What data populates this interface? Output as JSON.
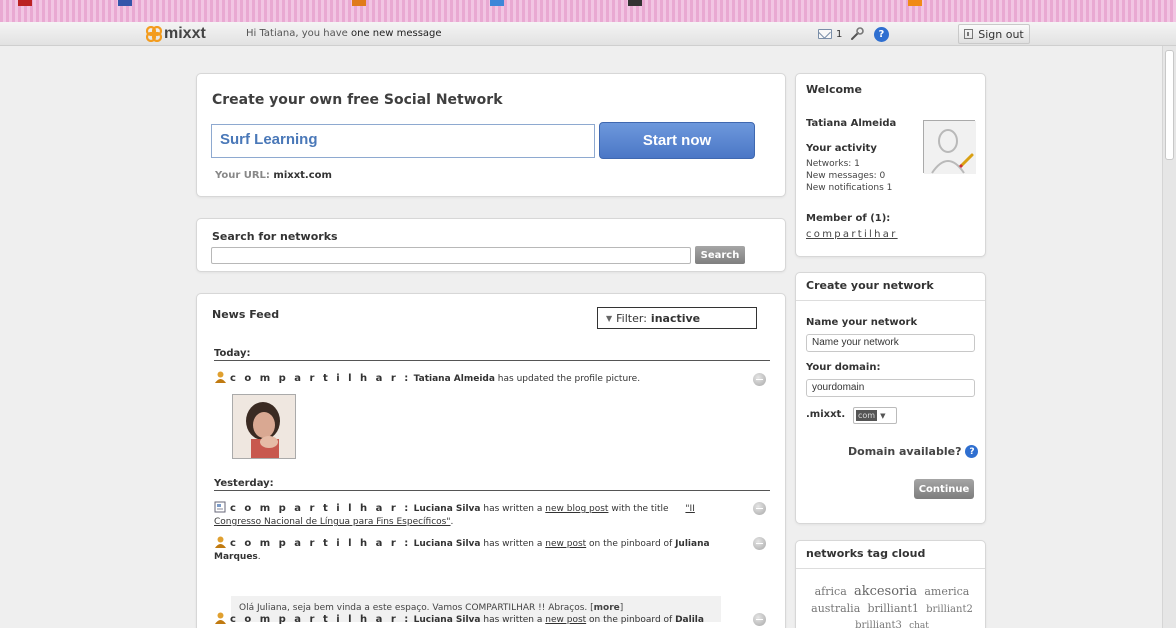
{
  "topbar": {
    "logo": "mixxt",
    "greeting_prefix": "Hi Tatiana, you have",
    "greeting_highlight": "one new message",
    "message_count": "1",
    "sign_out": "Sign out"
  },
  "create_network_hero": {
    "title": "Create your own free Social Network",
    "network_name_value": "Surf Learning",
    "start_button": "Start now",
    "url_label": "Your URL:",
    "url_value": "mixxt.com"
  },
  "search": {
    "title": "Search for networks",
    "input_value": "",
    "button": "Search"
  },
  "news_feed": {
    "title": "News Feed",
    "filter_label": "Filter:",
    "filter_value": "inactive",
    "today_label": "Today:",
    "yesterday_label": "Yesterday:",
    "entries": [
      {
        "network": "c o m p a r t i l h a r :",
        "user": "Tatiana Almeida",
        "text": "has updated the profile picture."
      },
      {
        "network": "c o m p a r t i l h a r :",
        "user": "Luciana Silva",
        "text_a": "has written a",
        "link_a": "new blog post",
        "text_b": "with the title",
        "link_b": "\"II Congresso Nacional de Língua para Fins Específicos\"",
        "text_c": "."
      },
      {
        "network": "c o m p a r t i l h a r :",
        "user": "Luciana Silva",
        "text_a": "has written a",
        "link_a": "new post",
        "text_b": "on the pinboard of",
        "target": "Juliana Marques",
        "text_c": ".",
        "comment": "Olá Juliana, seja bem vinda a este espaço. Vamos COMPARTILHAR !! Abraços.",
        "more": "more"
      },
      {
        "network": "c o m p a r t i l h a r :",
        "user": "Luciana Silva",
        "text_a": "has written a",
        "link_a": "new post",
        "text_b": "on the pinboard of",
        "target": "Dalila"
      }
    ]
  },
  "welcome": {
    "title": "Welcome",
    "name": "Tatiana Almeida",
    "activity_title": "Your activity",
    "networks": "Networks: 1",
    "new_messages": "New messages: 0",
    "new_notifications": "New notifications 1",
    "member_of": "Member of (1):",
    "member_network": "compartilhar"
  },
  "create_your_network": {
    "title": "Create your network",
    "name_label": "Name your network",
    "name_value": "Name your network",
    "domain_label": "Your domain:",
    "domain_value": "yourdomain",
    "tld_label": ".mixxt.",
    "tld_value": "com",
    "domain_available": "Domain available?",
    "continue": "Continue"
  },
  "tag_cloud": {
    "title": "networks tag cloud",
    "tags": [
      "africa",
      "akcesoria",
      "america",
      "australia",
      "brilliant1",
      "brilliant2",
      "brilliant3",
      "chat"
    ]
  },
  "colors": {
    "accent_blue": "#4b77c6",
    "link_blue": "#2f6fd0",
    "logo_orange": "#f39c1f"
  }
}
